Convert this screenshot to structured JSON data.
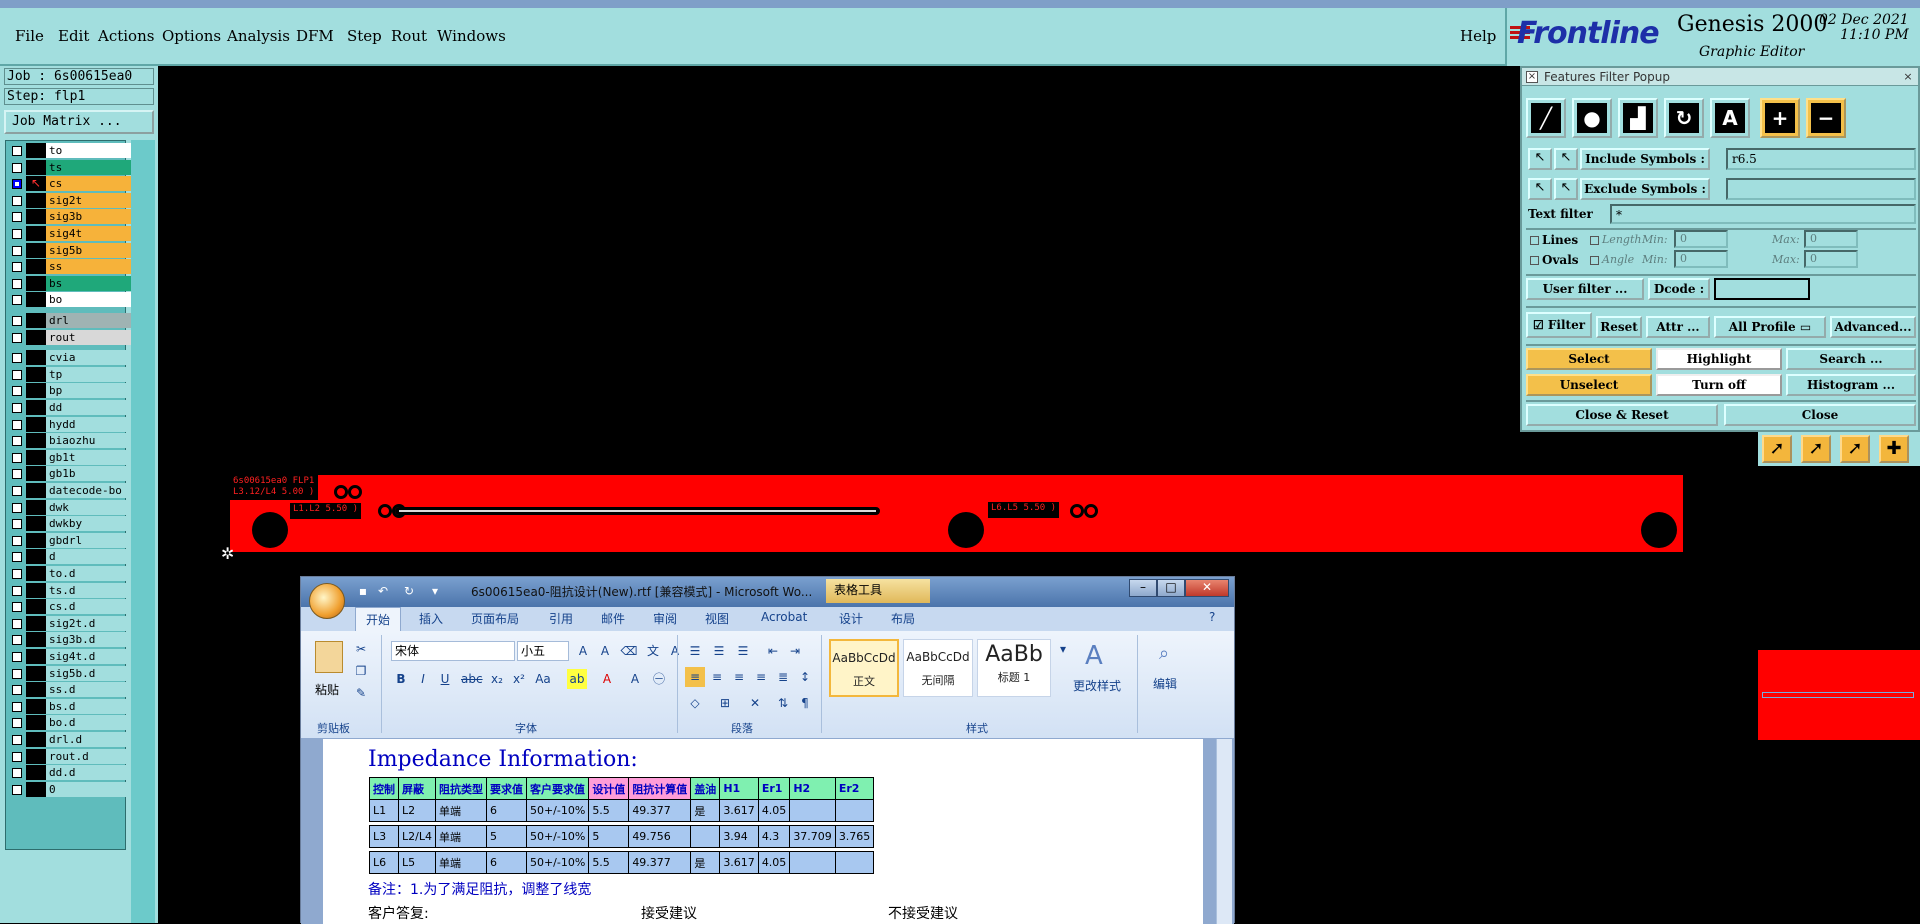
{
  "menubar": {
    "items": [
      "File",
      "Edit",
      "Actions",
      "Options",
      "Analysis",
      "DFM",
      "Step",
      "Rout",
      "Windows"
    ],
    "help": "Help"
  },
  "brand": {
    "logo": "Frontline",
    "product": "Genesis 2000",
    "subtitle": "Graphic Editor",
    "date": "02 Dec 2021",
    "time": "11:10 PM"
  },
  "leftpanel": {
    "job": "Job : 6s00615ea0",
    "step": "Step: flp1",
    "job_matrix": "Job Matrix ...",
    "layers": [
      {
        "name": "to",
        "color": "#ffffff"
      },
      {
        "name": "ts",
        "color": "#1fa87a"
      },
      {
        "name": "cs",
        "color": "#f6b23a",
        "active": true
      },
      {
        "name": "sig2t",
        "color": "#f6b23a"
      },
      {
        "name": "sig3b",
        "color": "#f6b23a"
      },
      {
        "name": "sig4t",
        "color": "#f6b23a"
      },
      {
        "name": "sig5b",
        "color": "#f6b23a"
      },
      {
        "name": "ss",
        "color": "#f6b23a"
      },
      {
        "name": "bs",
        "color": "#1fa87a"
      },
      {
        "name": "bo",
        "color": "#ffffff"
      },
      {
        "name": "drl",
        "color": "#9fb3b3",
        "gap": true
      },
      {
        "name": "rout",
        "color": "#d8d8d8"
      },
      {
        "name": "cvia",
        "color": "#a2dede",
        "gap": true
      },
      {
        "name": "tp",
        "color": "#a2dede"
      },
      {
        "name": "bp",
        "color": "#a2dede"
      },
      {
        "name": "dd",
        "color": "#a2dede"
      },
      {
        "name": "hydd",
        "color": "#a2dede"
      },
      {
        "name": "biaozhu",
        "color": "#a2dede"
      },
      {
        "name": "gb1t",
        "color": "#a2dede"
      },
      {
        "name": "gb1b",
        "color": "#a2dede"
      },
      {
        "name": "datecode-bo",
        "color": "#a2dede"
      },
      {
        "name": "dwk",
        "color": "#a2dede"
      },
      {
        "name": "dwkby",
        "color": "#a2dede"
      },
      {
        "name": "gbdrl",
        "color": "#a2dede"
      },
      {
        "name": "d",
        "color": "#a2dede"
      },
      {
        "name": "to.d",
        "color": "#a2dede"
      },
      {
        "name": "ts.d",
        "color": "#a2dede"
      },
      {
        "name": "cs.d",
        "color": "#a2dede"
      },
      {
        "name": "sig2t.d",
        "color": "#a2dede"
      },
      {
        "name": "sig3b.d",
        "color": "#a2dede"
      },
      {
        "name": "sig4t.d",
        "color": "#a2dede"
      },
      {
        "name": "sig5b.d",
        "color": "#a2dede"
      },
      {
        "name": "ss.d",
        "color": "#a2dede"
      },
      {
        "name": "bs.d",
        "color": "#a2dede"
      },
      {
        "name": "bo.d",
        "color": "#a2dede"
      },
      {
        "name": "drl.d",
        "color": "#a2dede"
      },
      {
        "name": "rout.d",
        "color": "#a2dede"
      },
      {
        "name": "dd.d",
        "color": "#a2dede"
      },
      {
        "name": "0",
        "color": "#a2dede"
      }
    ]
  },
  "pcb": {
    "label1": "6s00615ea0 FLP1",
    "label2": "L3.12/L4 5.00 )",
    "label3": "L1.L2 5.50 )",
    "label4": "L6.L5 5.50 )"
  },
  "popup": {
    "title": "Features Filter Popup",
    "include_label": "Include Symbols :",
    "include_value": "r6.5",
    "exclude_label": "Exclude Symbols :",
    "exclude_value": "",
    "text_filter_label": "Text filter",
    "text_filter_value": "*",
    "lines": "Lines",
    "ovals": "Ovals",
    "length": "Length",
    "angle": "Angle",
    "min": "Min:",
    "max": "Max:",
    "zero": "0",
    "user_filter": "User filter ...",
    "dcode": "Dcode :",
    "filter": "Filter",
    "reset": "Reset",
    "attr": "Attr ...",
    "all_profile": "All Profile",
    "advanced": "Advanced...",
    "select": "Select",
    "highlight": "Highlight",
    "search": "Search ...",
    "unselect": "Unselect",
    "turn_off": "Turn off",
    "histogram": "Histogram ...",
    "close_reset": "Close & Reset",
    "close": "Close"
  },
  "word": {
    "title": "6s00615ea0-阻抗设计(New).rtf [兼容模式] - Microsoft Wo...",
    "table_tools": "表格工具",
    "tabs": [
      "开始",
      "插入",
      "页面布局",
      "引用",
      "邮件",
      "审阅",
      "视图",
      "Acrobat",
      "设计",
      "布局"
    ],
    "clipboard": "剪贴板",
    "paste": "粘贴",
    "font_name": "宋体",
    "font_size": "小五",
    "font_group": "字体",
    "paragraph_group": "段落",
    "styles_group": "样式",
    "style_sample": "AaBbCcDd",
    "style_sample_big": "AaBb",
    "style1": "正文",
    "style2": "无间隔",
    "style3": "标题 1",
    "change_styles": "更改样式",
    "edit": "编辑",
    "heading": "Impedance Information:",
    "table_headers": [
      "控制",
      "屏蔽",
      "阻抗类型",
      "要求值",
      "客户要求值",
      "设计值",
      "阻抗计算值",
      "盖油",
      "H1",
      "Er1",
      "H2",
      "Er2"
    ],
    "table_rows": [
      [
        "L1",
        "L2",
        "单端",
        "6",
        "50+/-10%",
        "5.5",
        "49.377",
        "是",
        "3.617",
        "4.05",
        "",
        ""
      ],
      [
        "L3",
        "L2/L4",
        "单端",
        "5",
        "50+/-10%",
        "5",
        "49.756",
        "",
        "3.94",
        "4.3",
        "37.709",
        "3.765"
      ],
      [
        "L6",
        "L5",
        "单端",
        "6",
        "50+/-10%",
        "5.5",
        "49.377",
        "是",
        "3.617",
        "4.05",
        "",
        ""
      ]
    ],
    "note": "备注：1.为了满足阻抗，调整了线宽",
    "reply": "客户答复:",
    "accept": "接受建议",
    "reject": "不接受建议"
  },
  "colors": {
    "ui_bg": "#a2dede",
    "pcb_red": "#ff0000",
    "orange_btn": "#f3c04a",
    "brand_blue": "#1d2fa8"
  }
}
